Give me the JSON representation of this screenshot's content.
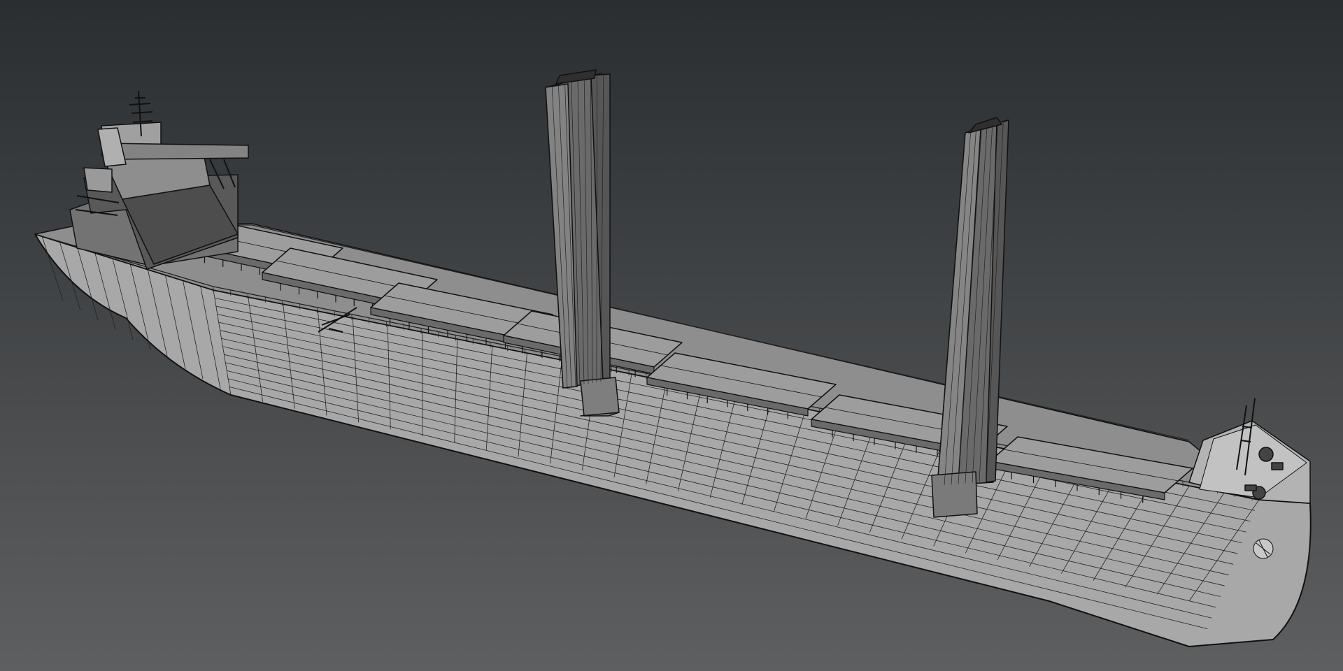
{
  "viewport": {
    "background_top": "#2a2e31",
    "background_bottom": "#5e5f60",
    "wire_color": "#111111"
  },
  "model": {
    "hull_color": "#a9a9a9",
    "deck_color": "#8d8d8d",
    "hatch_color": "#9d9d9d",
    "superstructure_color": "#6a6a6a",
    "sail_color": "#656565",
    "hatch_count": 7,
    "sail_count": 2
  }
}
